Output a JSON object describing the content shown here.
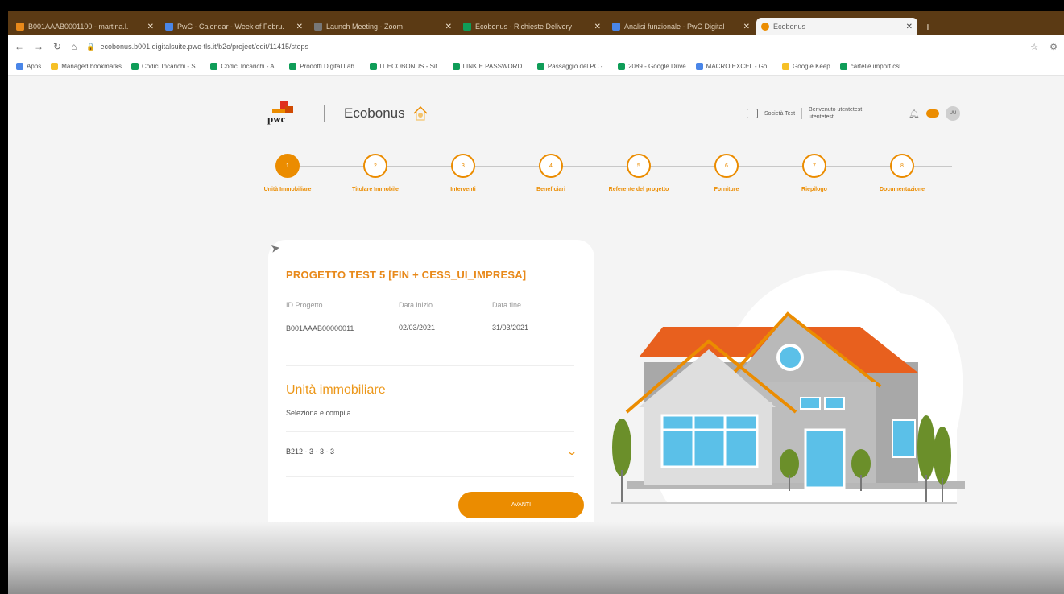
{
  "browser": {
    "tabs": [
      {
        "title": "B001AAAB0001100 - martina.l.",
        "color": "#e8891a"
      },
      {
        "title": "PwC - Calendar - Week of Febru.",
        "color": "#4a86e8"
      },
      {
        "title": "Launch Meeting - Zoom",
        "color": "#777777"
      },
      {
        "title": "Ecobonus - Richieste Delivery",
        "color": "#0f9d58"
      },
      {
        "title": "Analisi funzionale - PwC Digital",
        "color": "#4a86e8"
      },
      {
        "title": "Ecobonus",
        "color": "#eb8c00",
        "active": true
      }
    ],
    "new_tab": "+",
    "url": "ecobonus.b001.digitalsuite.pwc-tls.it/b2c/project/edit/11415/steps",
    "bookmarks": [
      {
        "label": "Apps",
        "color": "#4a86e8"
      },
      {
        "label": "Managed bookmarks",
        "color": "#f6c026"
      },
      {
        "label": "Codici Incarichi - S...",
        "color": "#0f9d58"
      },
      {
        "label": "Codici Incarichi - A...",
        "color": "#0f9d58"
      },
      {
        "label": "Prodotti Digital Lab...",
        "color": "#0f9d58"
      },
      {
        "label": "IT ECOBONUS - Sit...",
        "color": "#0f9d58"
      },
      {
        "label": "LINK E PASSWORD...",
        "color": "#0f9d58"
      },
      {
        "label": "Passaggio del PC -...",
        "color": "#0f9d58"
      },
      {
        "label": "2089 - Google Drive",
        "color": "#0f9d58"
      },
      {
        "label": "MACRO EXCEL - Go...",
        "color": "#4a86e8"
      },
      {
        "label": "Google Keep",
        "color": "#f6c026"
      },
      {
        "label": "cartelle import csl",
        "color": "#0f9d58"
      }
    ]
  },
  "header": {
    "logo_text": "pwc",
    "app_name": "Ecobonus",
    "company": "Società Test",
    "welcome_line1": "Benvenuto utentetest",
    "welcome_line2": "utentetest",
    "avatar_initials": "UU"
  },
  "stepper": {
    "steps": [
      {
        "num": "1",
        "label": "Unità Immobiliare",
        "active": true
      },
      {
        "num": "2",
        "label": "Titolare Immobile",
        "active": false
      },
      {
        "num": "3",
        "label": "Interventi",
        "active": false
      },
      {
        "num": "4",
        "label": "Beneficiari",
        "active": false
      },
      {
        "num": "5",
        "label": "Referente del progetto",
        "active": false
      },
      {
        "num": "6",
        "label": "Forniture",
        "active": false
      },
      {
        "num": "7",
        "label": "Riepilogo",
        "active": false
      },
      {
        "num": "8",
        "label": "Documentazione",
        "active": false
      }
    ]
  },
  "card": {
    "title": "PROGETTO TEST 5 [FIN + CESS_UI_IMPRESA]",
    "labels": {
      "id": "ID Progetto",
      "start": "Data inizio",
      "end": "Data fine"
    },
    "values": {
      "id": "B001AAAB00000011",
      "start": "02/03/2021",
      "end": "31/03/2021"
    },
    "section_title": "Unità immobiliare",
    "section_subtitle": "Seleziona e compila",
    "select_value": "B212 - 3 - 3 - 3",
    "button_label": "AVANTI"
  },
  "colors": {
    "accent": "#eb8c00",
    "tabbar": "#5b3a14",
    "roof": "#e8601e"
  }
}
